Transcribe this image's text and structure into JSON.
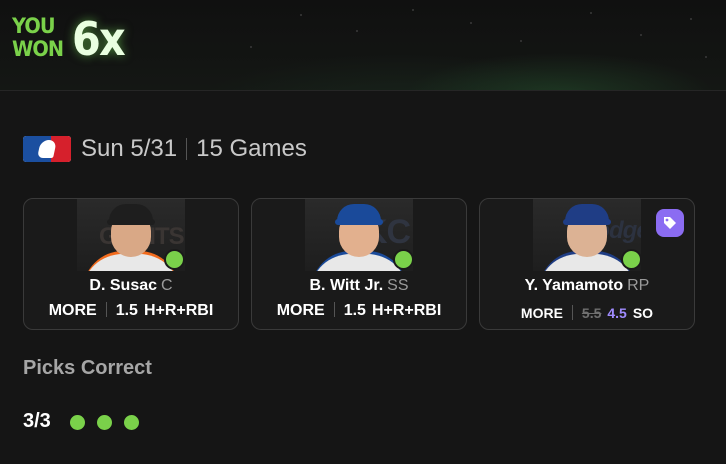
{
  "banner": {
    "line1": "YOU",
    "line2": "WON",
    "multiplier": "6x"
  },
  "slate": {
    "league_icon": "mlb-logo",
    "date": "Sun 5/31",
    "games": "15 Games"
  },
  "cards": [
    {
      "name": "D. Susac",
      "position": "C",
      "team_watermark": "GIANTS",
      "cap_color": "#1e1e1e",
      "jersey_color": "#e8e8e8",
      "accent": "#f26b1d",
      "status": "correct",
      "pick": {
        "direction": "MORE",
        "line": "1.5",
        "stat": "H+R+RBI"
      }
    },
    {
      "name": "B. Witt Jr.",
      "position": "SS",
      "team_watermark": "KC",
      "cap_color": "#1a4a9a",
      "jersey_color": "#e8e8e8",
      "accent": "#1a4a9a",
      "status": "correct",
      "pick": {
        "direction": "MORE",
        "line": "1.5",
        "stat": "H+R+RBI"
      }
    },
    {
      "name": "Y. Yamamoto",
      "position": "RP",
      "team_watermark": "Dodgers",
      "cap_color": "#1f3d85",
      "jersey_color": "#e8e8e8",
      "accent": "#1f3d85",
      "status": "correct",
      "promo_icon": "tag-icon",
      "pick": {
        "direction": "MORE",
        "original_line": "5.5",
        "line": "4.5",
        "stat": "SO"
      }
    }
  ],
  "picks": {
    "title": "Picks Correct",
    "count": "3/3",
    "correct": 3,
    "total": 3
  },
  "colors": {
    "accent_green": "#7ad14a",
    "promo_purple": "#8b6cf2",
    "background": "#151515"
  }
}
